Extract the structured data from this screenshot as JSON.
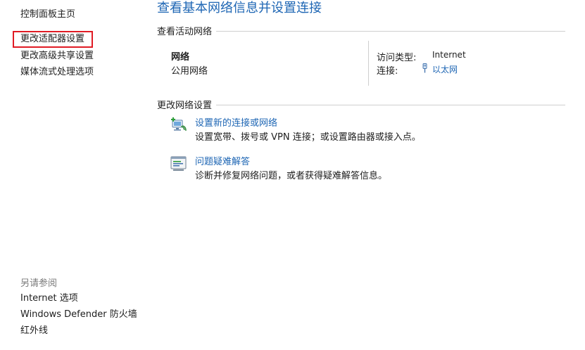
{
  "nav": {
    "home": "控制面板主页",
    "adapter": "更改适配器设置",
    "sharing": "更改高级共享设置",
    "media": "媒体流式处理选项"
  },
  "see_also": {
    "title": "另请参阅",
    "internet": "Internet 选项",
    "defender": "Windows Defender 防火墙",
    "infrared": "红外线"
  },
  "main": {
    "title": "查看基本网络信息并设置连接",
    "active_section": "查看活动网络",
    "network_name": "网络",
    "network_category": "公用网络",
    "access_type_label": "访问类型:",
    "access_type_value": "Internet",
    "connections_label": "连接:",
    "connections_value": "以太网",
    "change_section": "更改网络设置",
    "tasks": [
      {
        "title": "设置新的连接或网络",
        "desc": "设置宽带、拨号或 VPN 连接；或设置路由器或接入点。",
        "icon": "new-connection-icon"
      },
      {
        "title": "问题疑难解答",
        "desc": "诊断并修复网络问题，或者获得疑难解答信息。",
        "icon": "troubleshoot-icon"
      }
    ]
  },
  "colors": {
    "link_blue": "#1e66b4",
    "highlight_red": "#e01b24",
    "muted_gray": "#7a7a7a"
  }
}
